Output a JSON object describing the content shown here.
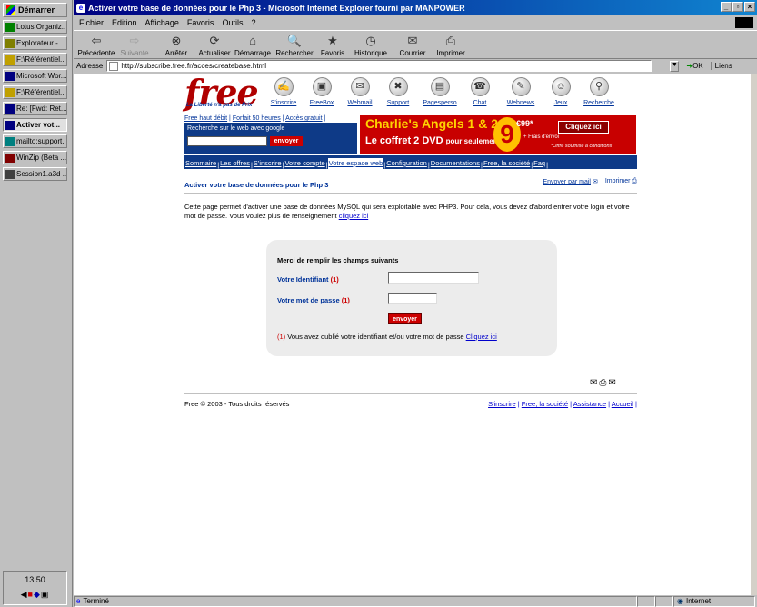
{
  "taskbar": {
    "start_label": "Démarrer",
    "items": [
      {
        "label": "Lotus Organiz...",
        "color": "#008000"
      },
      {
        "label": "Explorateur - ...",
        "color": "#808000"
      },
      {
        "label": "F:\\Référentiel...",
        "color": "#c0a000"
      },
      {
        "label": "Microsoft Wor...",
        "color": "#000080"
      },
      {
        "label": "F:\\Référentiel...",
        "color": "#c0a000"
      },
      {
        "label": "Re: [Fwd: Ret...",
        "color": "#000080"
      },
      {
        "label": "Activer vot...",
        "color": "#000080",
        "active": true
      },
      {
        "label": "mailto:support...",
        "color": "#008080"
      },
      {
        "label": "WinZip (Beta ...",
        "color": "#800000"
      },
      {
        "label": "Session1.a3d ...",
        "color": "#404040"
      }
    ],
    "clock": "13:50"
  },
  "window": {
    "title": "Activer votre base de données pour le Php 3 - Microsoft Internet Explorer fourni par MANPOWER",
    "menu": [
      "Fichier",
      "Edition",
      "Affichage",
      "Favoris",
      "Outils",
      "?"
    ],
    "toolbar": [
      {
        "label": "Précédente",
        "icon": "back-arrow-icon",
        "glyph": "⇦",
        "disabled": false
      },
      {
        "label": "Suivante",
        "icon": "forward-arrow-icon",
        "glyph": "⇨",
        "disabled": true
      },
      {
        "label": "Arrêter",
        "icon": "stop-icon",
        "glyph": "⊗",
        "disabled": false
      },
      {
        "label": "Actualiser",
        "icon": "refresh-icon",
        "glyph": "⟳",
        "disabled": false
      },
      {
        "label": "Démarrage",
        "icon": "home-icon",
        "glyph": "⌂",
        "disabled": false
      },
      {
        "label": "Rechercher",
        "icon": "search-icon",
        "glyph": "🔍",
        "disabled": false
      },
      {
        "label": "Favoris",
        "icon": "favorites-icon",
        "glyph": "★",
        "disabled": false
      },
      {
        "label": "Historique",
        "icon": "history-icon",
        "glyph": "◷",
        "disabled": false
      },
      {
        "label": "Courrier",
        "icon": "mail-icon",
        "glyph": "✉",
        "disabled": false
      },
      {
        "label": "Imprimer",
        "icon": "print-icon",
        "glyph": "⎙",
        "disabled": false
      }
    ],
    "address_label": "Adresse",
    "address": "http://subscribe.free.fr/acces/createbase.html",
    "go_label": "OK",
    "links_label": "Liens",
    "status_text": "Terminé",
    "zone_text": "Internet"
  },
  "site": {
    "logo": "free",
    "slogan": "La Liberté n'a pas de Prix",
    "nav_icons": [
      {
        "label": "S'inscrire",
        "icon": "signup-icon",
        "glyph": "✍"
      },
      {
        "label": "FreeBox",
        "icon": "freebox-icon",
        "glyph": "▣"
      },
      {
        "label": "Webmail",
        "icon": "webmail-icon",
        "glyph": "✉"
      },
      {
        "label": "Support",
        "icon": "support-icon",
        "glyph": "✖"
      },
      {
        "label": "Pagesperso",
        "icon": "pagesperso-icon",
        "glyph": "▤"
      },
      {
        "label": "Chat",
        "icon": "chat-icon",
        "glyph": "☎"
      },
      {
        "label": "Webnews",
        "icon": "webnews-icon",
        "glyph": "✎"
      },
      {
        "label": "Jeux",
        "icon": "games-icon",
        "glyph": "☺"
      },
      {
        "label": "Recherche",
        "icon": "search-icon",
        "glyph": "⚲"
      }
    ],
    "top_links": [
      "Free haut débit",
      "Forfait 50 heures",
      "Accès gratuit"
    ],
    "search_label": "Recherche sur le web avec google",
    "search_button": "envoyer",
    "banner": {
      "title": "Charlie's Angels 1 & 2",
      "subtitle": "Le coffret 2 DVD",
      "subtitle_small": "pour seulement",
      "price": "9",
      "price_cents": "€99*",
      "fees": "+ Frais d'envoi",
      "cta": "Cliquez ici",
      "offer": "*Offre soumise à conditions"
    },
    "main_nav": [
      "Sommaire",
      "Les offres",
      "S'inscrire",
      "Votre compte",
      "Votre espace web",
      "Configuration",
      "Documentations",
      "Free, la société",
      "Faq"
    ],
    "main_nav_current": "Votre espace web",
    "page_title": "Activer votre base de données pour le Php 3",
    "send_mail": "Envoyer par mail",
    "print": "Imprimer",
    "intro": "Cette page permet d'activer une base de données MySQL qui sera exploitable avec PHP3. Pour cela, vous devez d'abord entrer votre login et votre mot de passe. Vous voulez plus de renseignement ",
    "intro_link": "cliquez ici",
    "form": {
      "heading": "Merci de remplir les champs suivants",
      "login_label": "Votre Identifiant ",
      "password_label": "Votre mot de passe ",
      "marker": "(1)",
      "submit": "envoyer",
      "forgot_text": " Vous avez oublié votre identifiant et/ou votre mot de passe ",
      "forgot_link": "Cliquez ici",
      "login_value": "",
      "password_value": ""
    },
    "footer_left": "Free © 2003 - Tous droits réservés",
    "footer_links": [
      "S'inscrire",
      "Free, la société",
      "Assistance",
      "Accueil"
    ]
  },
  "colors": {
    "brand_red": "#b00000",
    "brand_blue": "#0e3a87",
    "link": "#0000cc"
  }
}
